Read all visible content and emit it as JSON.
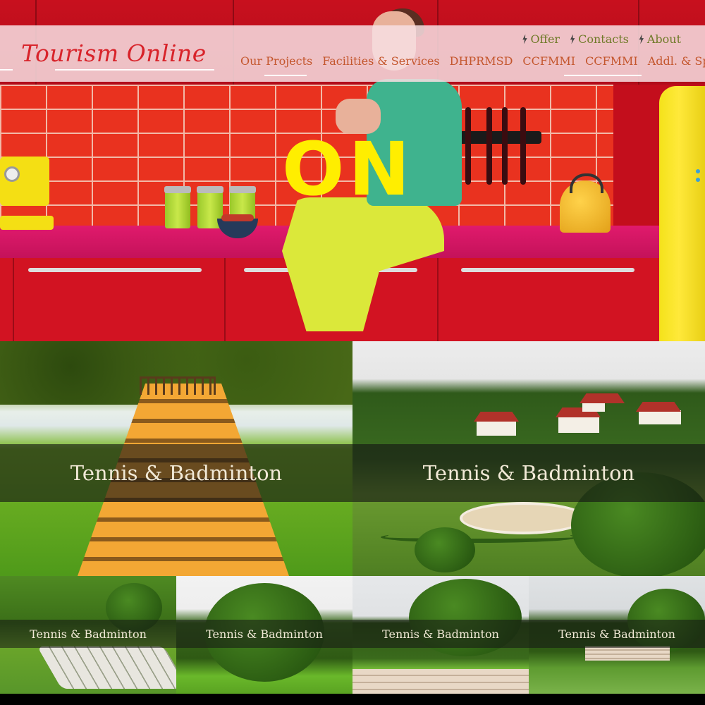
{
  "header": {
    "logo_text": "Tourism Online",
    "utility_nav": [
      {
        "label": "Offer",
        "icon": "bolt-icon"
      },
      {
        "label": "Contacts",
        "icon": "bolt-icon"
      },
      {
        "label": "About",
        "icon": "bolt-icon"
      }
    ],
    "main_nav": [
      {
        "label": "Our Projects"
      },
      {
        "label": "Facilities & Services"
      },
      {
        "label": "DHPRMSD"
      },
      {
        "label": "CCFMMI"
      },
      {
        "label": "CCFMMI"
      },
      {
        "label": "Addl. & Spl"
      }
    ]
  },
  "hero": {
    "word": "ON"
  },
  "tiles": {
    "large": [
      {
        "caption": "Tennis & Badminton"
      },
      {
        "caption": "Tennis & Badminton"
      }
    ],
    "small": [
      {
        "caption": "Tennis & Badminton"
      },
      {
        "caption": "Tennis & Badminton"
      },
      {
        "caption": "Tennis & Badminton"
      },
      {
        "caption": "Tennis & Badminton"
      }
    ]
  },
  "colors": {
    "logo": "#d8232a",
    "utility_nav_text": "#6f7a28",
    "main_nav_text": "#c4562d",
    "header_bg": "#f7dee2",
    "hero_word": "#ffee00",
    "caption_text": "#f1e9d6"
  }
}
